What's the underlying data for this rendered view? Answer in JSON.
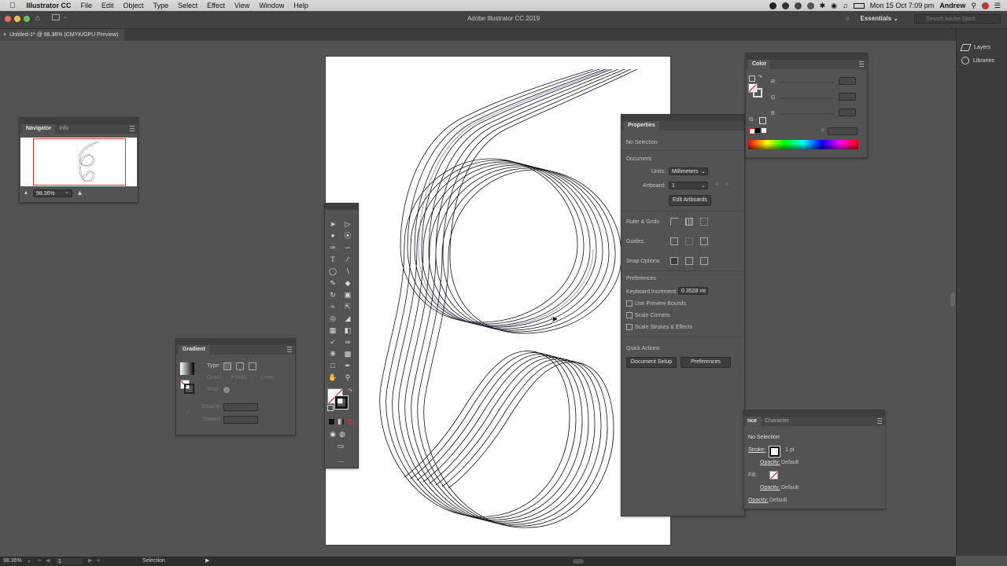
{
  "menubar": {
    "app_name": "Illustrator CC",
    "items": [
      "File",
      "Edit",
      "Object",
      "Type",
      "Select",
      "Effect",
      "View",
      "Window",
      "Help"
    ],
    "clock": "Mon 15 Oct  7:09 pm",
    "user": "Andrew"
  },
  "titlebar": {
    "title": "Adobe Illustrator CC 2019",
    "workspace": "Essentials",
    "search_placeholder": "Search Adobe Stock"
  },
  "document": {
    "tab_label": "Untitled-1* @ 98.36% (CMYK/GPU Preview)"
  },
  "right_dock": {
    "items": [
      {
        "label": "Layers",
        "icon": "layers-icon"
      },
      {
        "label": "Libraries",
        "icon": "libraries-icon"
      }
    ]
  },
  "navigator": {
    "tabs": [
      "Navigator",
      "Info"
    ],
    "zoom": "98.36%"
  },
  "gradient_panel": {
    "title": "Gradient",
    "type_label": "Type:",
    "draw_label": "Draw:",
    "draw_options": [
      "Points",
      "Lines"
    ],
    "stop_label": "Stop:",
    "opacity_label": "Opacity:",
    "spread_label": "Spread:"
  },
  "color_panel": {
    "title": "Color",
    "channels": [
      "R",
      "G",
      "B"
    ],
    "hash": "#"
  },
  "properties_panel": {
    "title": "Properties",
    "selection": "No Selection",
    "document_heading": "Document",
    "units_label": "Units:",
    "units_value": "Millimeters",
    "artboard_label": "Artboard:",
    "artboard_value": "1",
    "edit_artboards": "Edit Artboards",
    "ruler_grids": "Ruler & Grids",
    "guides": "Guides",
    "snap_options": "Snap Options",
    "preferences_heading": "Preferences",
    "keyboard_increment_label": "Keyboard Increment:",
    "keyboard_increment_value": "0.3528 mr",
    "checkboxes": [
      "Use Preview Bounds",
      "Scale Corners",
      "Scale Strokes & Effects"
    ],
    "quick_actions": "Quick Actions",
    "document_setup": "Document Setup",
    "preferences_button": "Preferences"
  },
  "appearance_panel": {
    "tabs": [
      "nce",
      "Character"
    ],
    "selection": "No Selection",
    "stroke_label": "Stroke:",
    "stroke_value": "1 pt",
    "opacity1": "Opacity:",
    "opacity1_value": "Default",
    "fill_label": "Fill:",
    "opacity2": "Opacity:",
    "opacity2_value": "Default",
    "opacity3": "Opacity:",
    "opacity3_value": "Default"
  },
  "statusbar": {
    "zoom": "98.36%",
    "artboard": "1",
    "tool": "Selection"
  },
  "colors": {
    "spectrum": [
      "#ff0000",
      "#ffff00",
      "#00ff00",
      "#00ffff",
      "#0000ff",
      "#ff00ff",
      "#ff0000"
    ]
  }
}
